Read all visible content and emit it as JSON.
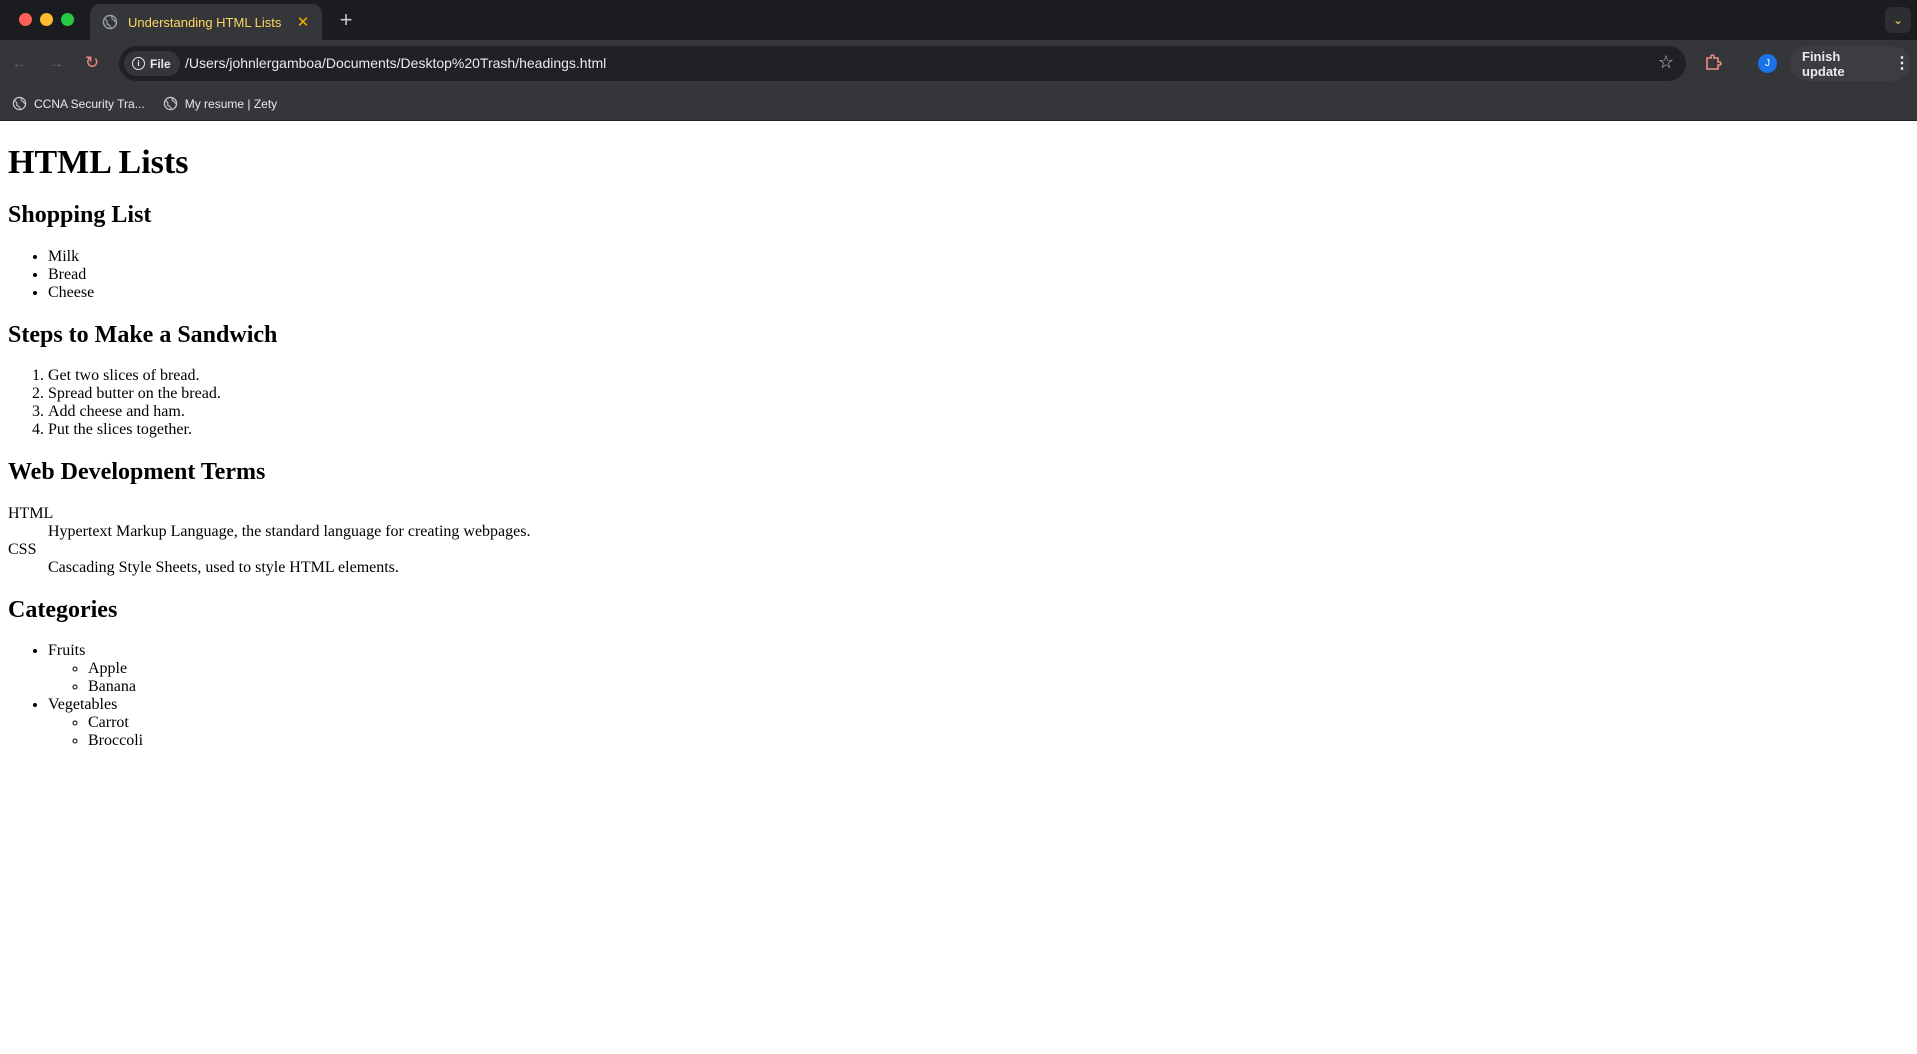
{
  "browser": {
    "tab_title": "Understanding HTML Lists",
    "new_tab_label": "+",
    "url_chip": "File",
    "url": "/Users/johnlergamboa/Documents/Desktop%20Trash/headings.html",
    "avatar_initial": "J",
    "finish_update_label": "Finish update",
    "bookmarks": [
      {
        "label": "CCNA Security Tra..."
      },
      {
        "label": "My resume | Zety"
      }
    ]
  },
  "page": {
    "title": "HTML Lists",
    "shopping": {
      "heading": "Shopping List",
      "items": [
        "Milk",
        "Bread",
        "Cheese"
      ]
    },
    "sandwich": {
      "heading": "Steps to Make a Sandwich",
      "steps": [
        "Get two slices of bread.",
        "Spread butter on the bread.",
        "Add cheese and ham.",
        "Put the slices together."
      ]
    },
    "terms": {
      "heading": "Web Development Terms",
      "entries": [
        {
          "term": "HTML",
          "definition": "Hypertext Markup Language, the standard language for creating webpages."
        },
        {
          "term": "CSS",
          "definition": "Cascading Style Sheets, used to style HTML elements."
        }
      ]
    },
    "categories": {
      "heading": "Categories",
      "groups": [
        {
          "name": "Fruits",
          "items": [
            "Apple",
            "Banana"
          ]
        },
        {
          "name": "Vegetables",
          "items": [
            "Carrot",
            "Broccoli"
          ]
        }
      ]
    }
  }
}
